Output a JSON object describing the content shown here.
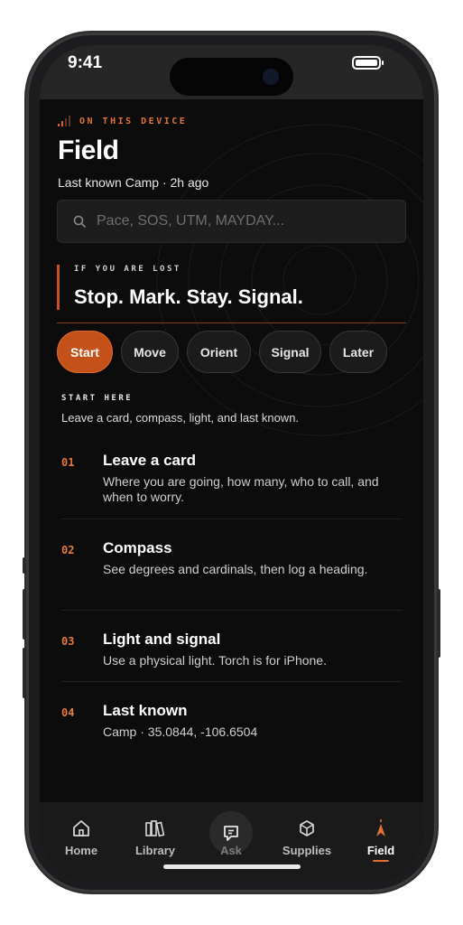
{
  "status_bar": {
    "time": "9:41"
  },
  "header": {
    "device_label": "ON THIS DEVICE",
    "title": "Field",
    "subtitle": "Last known Camp · 2h ago"
  },
  "search": {
    "placeholder": "Pace, SOS, UTM, MAYDAY..."
  },
  "lost_card": {
    "label": "IF YOU ARE LOST",
    "motto": "Stop. Mark. Stay. Signal."
  },
  "chips": [
    {
      "label": "Start",
      "active": true
    },
    {
      "label": "Move",
      "active": false
    },
    {
      "label": "Orient",
      "active": false
    },
    {
      "label": "Signal",
      "active": false
    },
    {
      "label": "Later",
      "active": false
    }
  ],
  "start_section": {
    "label": "START HERE",
    "description": "Leave a card, compass, light, and last known."
  },
  "steps": [
    {
      "num": "01",
      "title": "Leave a card",
      "desc": "Where you are going, how many, who to call, and when to worry."
    },
    {
      "num": "02",
      "title": "Compass",
      "desc": "See degrees and cardinals, then log a heading."
    },
    {
      "num": "03",
      "title": "Light and signal",
      "desc": "Use a physical light. Torch is for iPhone."
    },
    {
      "num": "04",
      "title": "Last known",
      "desc": "Camp · 35.0844, -106.6504"
    }
  ],
  "tabs": [
    {
      "label": "Home",
      "icon": "home-icon"
    },
    {
      "label": "Library",
      "icon": "library-icon"
    },
    {
      "label": "Ask",
      "icon": "chat-icon"
    },
    {
      "label": "Supplies",
      "icon": "box-icon"
    },
    {
      "label": "Field",
      "icon": "compass-arrow-icon",
      "active": true
    }
  ],
  "colors": {
    "accent": "#c4501a",
    "background": "#0c0c0c"
  }
}
